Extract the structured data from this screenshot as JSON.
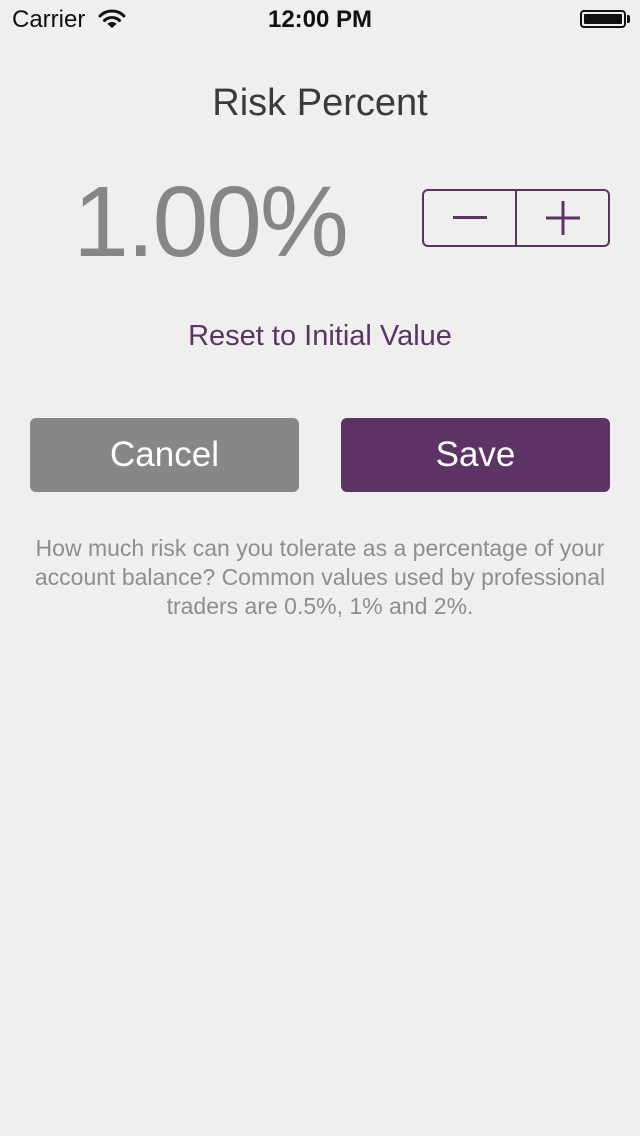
{
  "status_bar": {
    "carrier": "Carrier",
    "time": "12:00 PM"
  },
  "screen": {
    "title": "Risk Percent",
    "value": "1.00%",
    "reset_label": "Reset to Initial Value",
    "cancel_label": "Cancel",
    "save_label": "Save",
    "help_text": "How much risk can you tolerate as a percentage of your account balance? Common values used by professional traders are 0.5%, 1% and 2%."
  },
  "icons": {
    "wifi": "wifi-icon",
    "battery": "battery-icon",
    "decrement": "minus-icon",
    "increment": "plus-icon"
  },
  "colors": {
    "background": "#efefed",
    "accent": "#5d3366",
    "cancel": "#878886",
    "value_text": "#868686",
    "help_text": "#8e8e8e"
  }
}
